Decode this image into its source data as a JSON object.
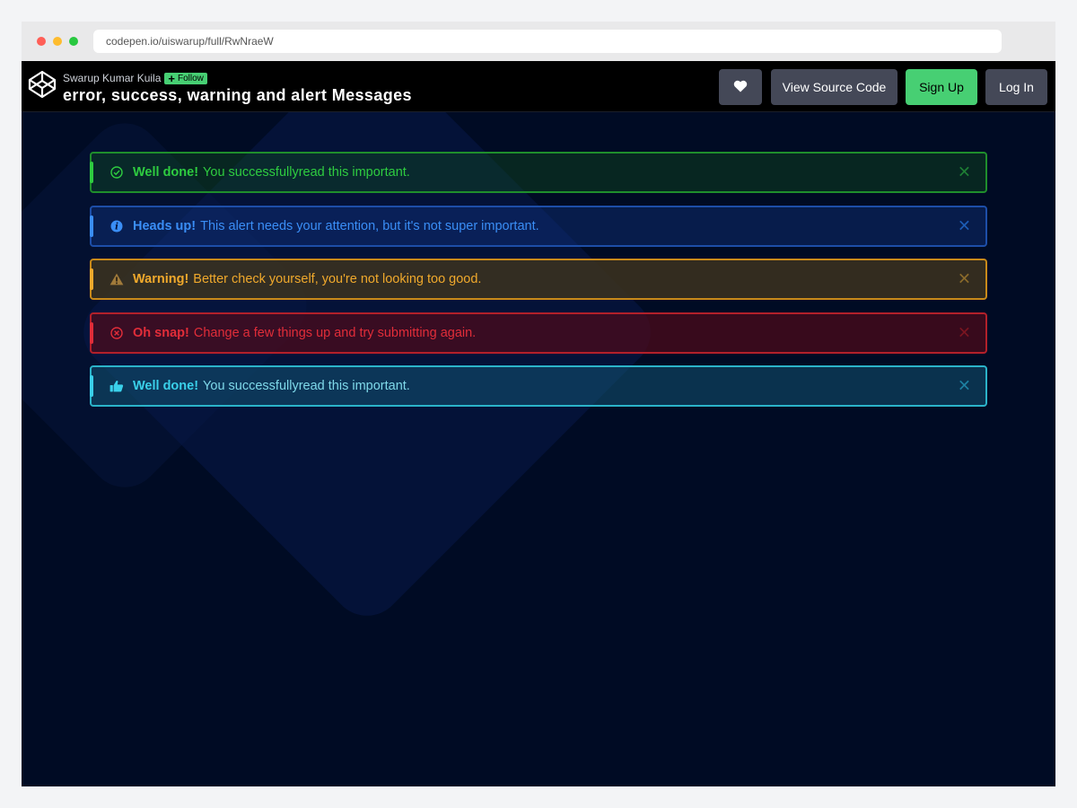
{
  "browser": {
    "url": "codepen.io/uiswarup/full/RwNraeW"
  },
  "header": {
    "author": "Swarup Kumar Kuila",
    "follow_label": "Follow",
    "title": "error, success, warning and alert Messages",
    "buttons": {
      "heart_icon": "heart-icon",
      "view_source": "View Source Code",
      "sign_up": "Sign Up",
      "log_in": "Log In"
    }
  },
  "alerts": [
    {
      "type": "success",
      "icon": "check-circle-icon",
      "title": "Well done!",
      "message": "You successfullyread this important.",
      "color": "#2ecc40"
    },
    {
      "type": "info",
      "icon": "info-circle-icon",
      "title": "Heads up!",
      "message": "This alert needs your attention, but it's not super important.",
      "color": "#3a8ef6"
    },
    {
      "type": "warning",
      "icon": "warning-triangle-icon",
      "title": "Warning!",
      "message": "Better check yourself, you're not looking too good.",
      "color": "#f0a92c"
    },
    {
      "type": "danger",
      "icon": "times-circle-icon",
      "title": "Oh snap!",
      "message": "Change a few things up and try submitting again.",
      "color": "#e12d39"
    },
    {
      "type": "note",
      "icon": "thumbs-up-icon",
      "title": "Well done!",
      "message": "You successfullyread this important.",
      "color": "#3ad0ea"
    }
  ],
  "close_glyph": "✕"
}
